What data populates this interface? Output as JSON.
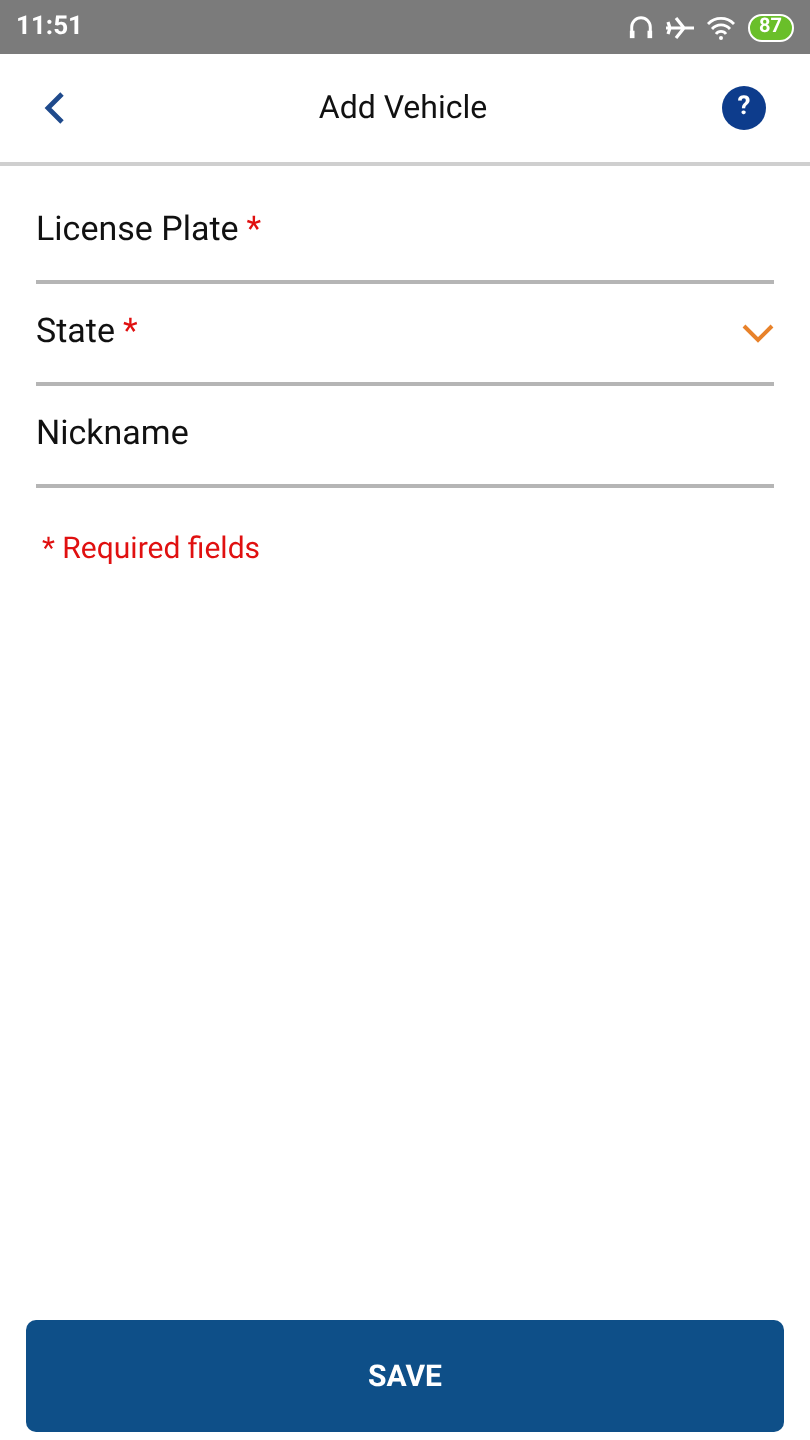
{
  "status_bar": {
    "time": "11:51",
    "battery": "87"
  },
  "header": {
    "title": "Add Vehicle",
    "help": "?"
  },
  "fields": [
    {
      "kind": "text",
      "placeholder": "License Plate",
      "required_mark": "*"
    },
    {
      "kind": "select",
      "placeholder": "State",
      "required_mark": "*"
    },
    {
      "kind": "text",
      "placeholder": "Nickname"
    }
  ],
  "required_note": "* Required fields",
  "save_button": "SAVE"
}
